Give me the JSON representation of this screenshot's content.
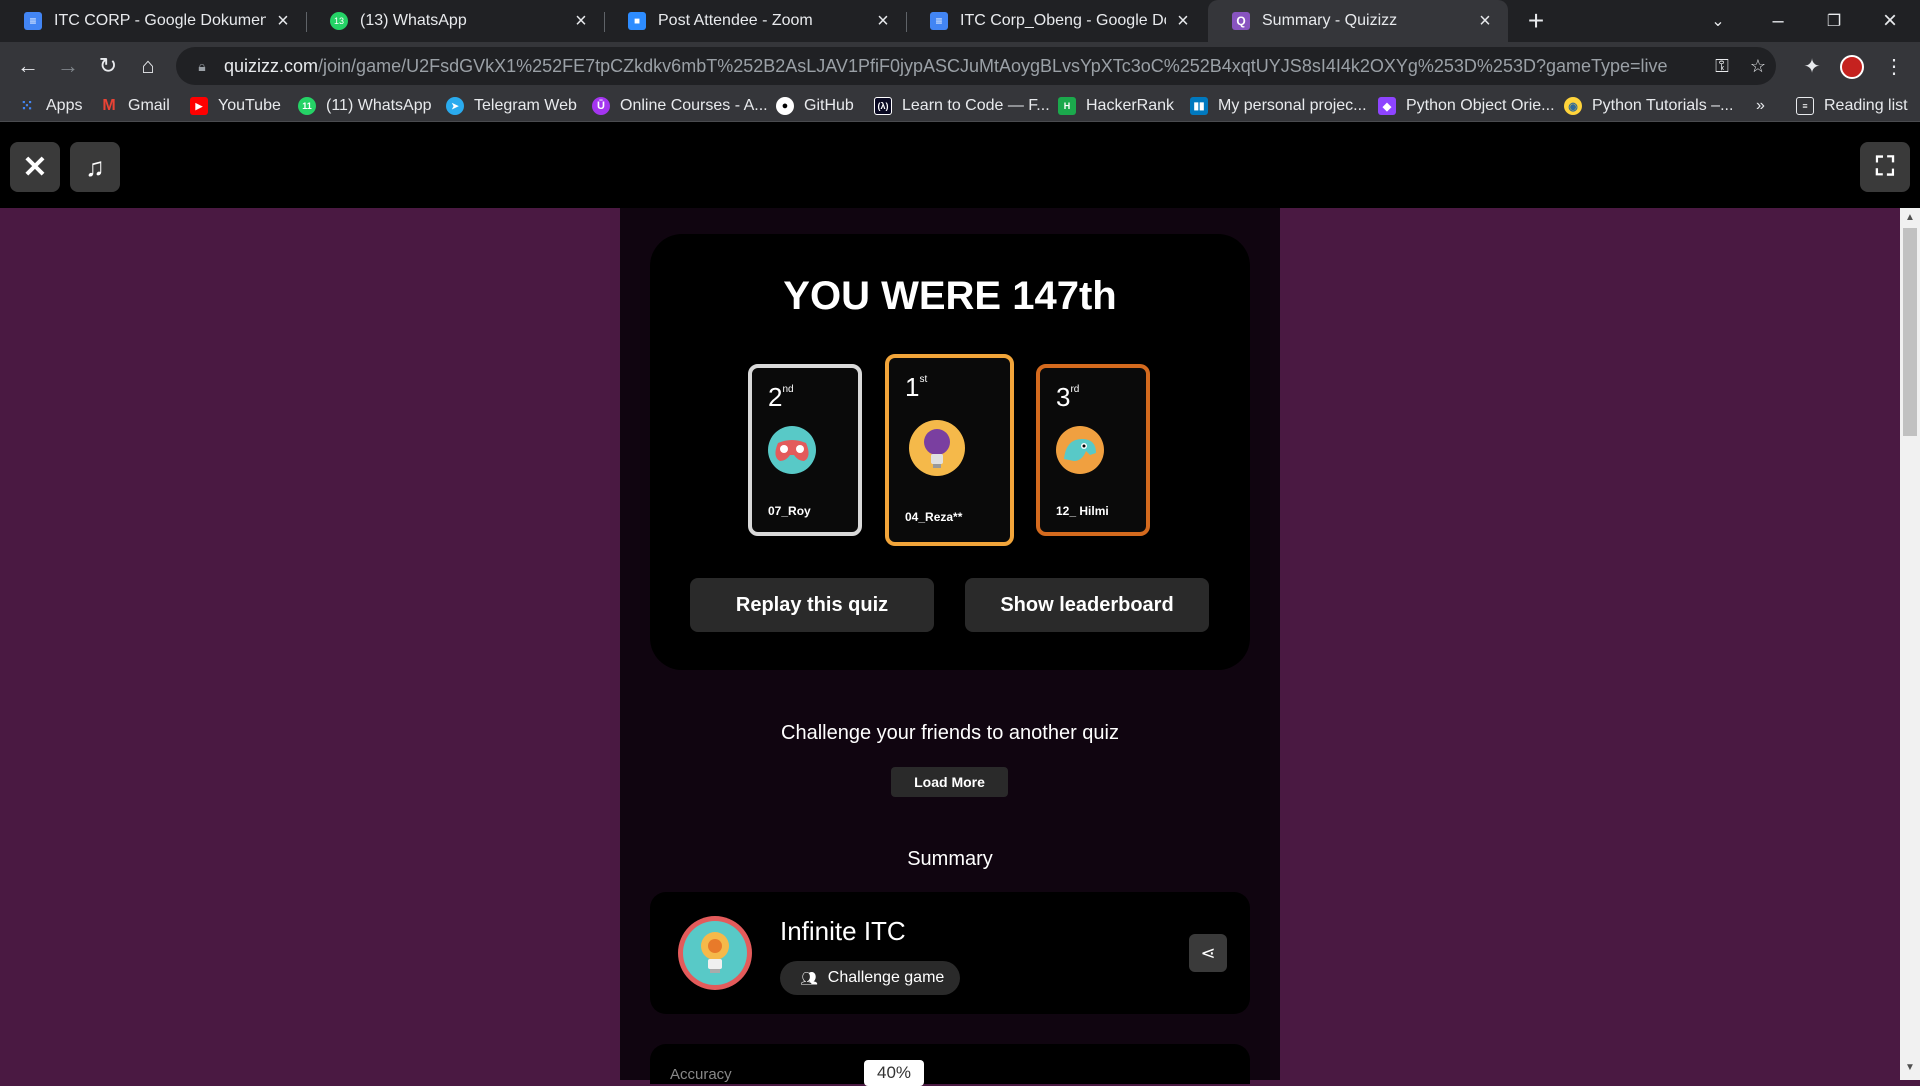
{
  "browser": {
    "tabs": [
      {
        "title": "ITC CORP - Google Dokumen",
        "icon": "google-docs-icon",
        "color": "#4285f4"
      },
      {
        "title": "(13) WhatsApp",
        "icon": "whatsapp-icon",
        "color": "#25d366"
      },
      {
        "title": "Post Attendee - Zoom",
        "icon": "zoom-icon",
        "color": "#2d8cff"
      },
      {
        "title": "ITC Corp_Obeng - Google Dokum",
        "icon": "google-docs-icon",
        "color": "#4285f4"
      },
      {
        "title": "Summary - Quizizz",
        "icon": "quizizz-icon",
        "color": "#8854c0"
      }
    ],
    "url_host": "quizizz.com",
    "url_path": "/join/game/U2FsdGVkX1%252FE7tpCZkdkv6mbT%252B2AsLJAV1PfiF0jypASCJuMtAoygBLvsYpXTc3oC%252B4xqtUYJS8sI4I4k2OXYg%253D%253D?gameType=live",
    "bookmarks": [
      {
        "label": "Apps",
        "icon": "apps-grid-icon",
        "color": "#ea4335"
      },
      {
        "label": "Gmail",
        "icon": "gmail-icon",
        "color": "#ea4335"
      },
      {
        "label": "YouTube",
        "icon": "youtube-icon",
        "color": "#ff0000"
      },
      {
        "label": "(11) WhatsApp",
        "icon": "whatsapp-icon",
        "color": "#25d366"
      },
      {
        "label": "Telegram Web",
        "icon": "telegram-icon",
        "color": "#2aabee"
      },
      {
        "label": "Online Courses - A...",
        "icon": "udemy-icon",
        "color": "#a435f0"
      },
      {
        "label": "GitHub",
        "icon": "github-icon",
        "color": "#ffffff"
      },
      {
        "label": "Learn to Code — F...",
        "icon": "freecodecamp-icon",
        "color": "#0a0a23"
      },
      {
        "label": "HackerRank",
        "icon": "hackerrank-icon",
        "color": "#1ba94c"
      },
      {
        "label": "My personal projec...",
        "icon": "trello-icon",
        "color": "#0079bf"
      },
      {
        "label": "Python Object Orie...",
        "icon": "python-icon",
        "color": "#8e44ff"
      },
      {
        "label": "Python Tutorials –...",
        "icon": "python-icon",
        "color": "#ffd43b"
      }
    ],
    "bookmarks_overflow": "»",
    "reading_list": "Reading list"
  },
  "result": {
    "title": "YOU WERE 147th",
    "podium": [
      {
        "place": "2",
        "suffix": "nd",
        "name": "07_Roy",
        "border": "#d9d9d9"
      },
      {
        "place": "1",
        "suffix": "st",
        "name": "04_Reza**",
        "border": "#f2a53a"
      },
      {
        "place": "3",
        "suffix": "rd",
        "name": "12_ Hilmi",
        "border": "#d46a1e"
      }
    ],
    "replay_label": "Replay this quiz",
    "leaderboard_label": "Show leaderboard"
  },
  "challenge": {
    "text": "Challenge your friends to another quiz",
    "load_more": "Load More"
  },
  "summary": {
    "title": "Summary",
    "quiz_name": "Infinite ITC",
    "challenge_label": "Challenge game",
    "accuracy_label": "Accuracy",
    "accuracy_value": "40%"
  }
}
